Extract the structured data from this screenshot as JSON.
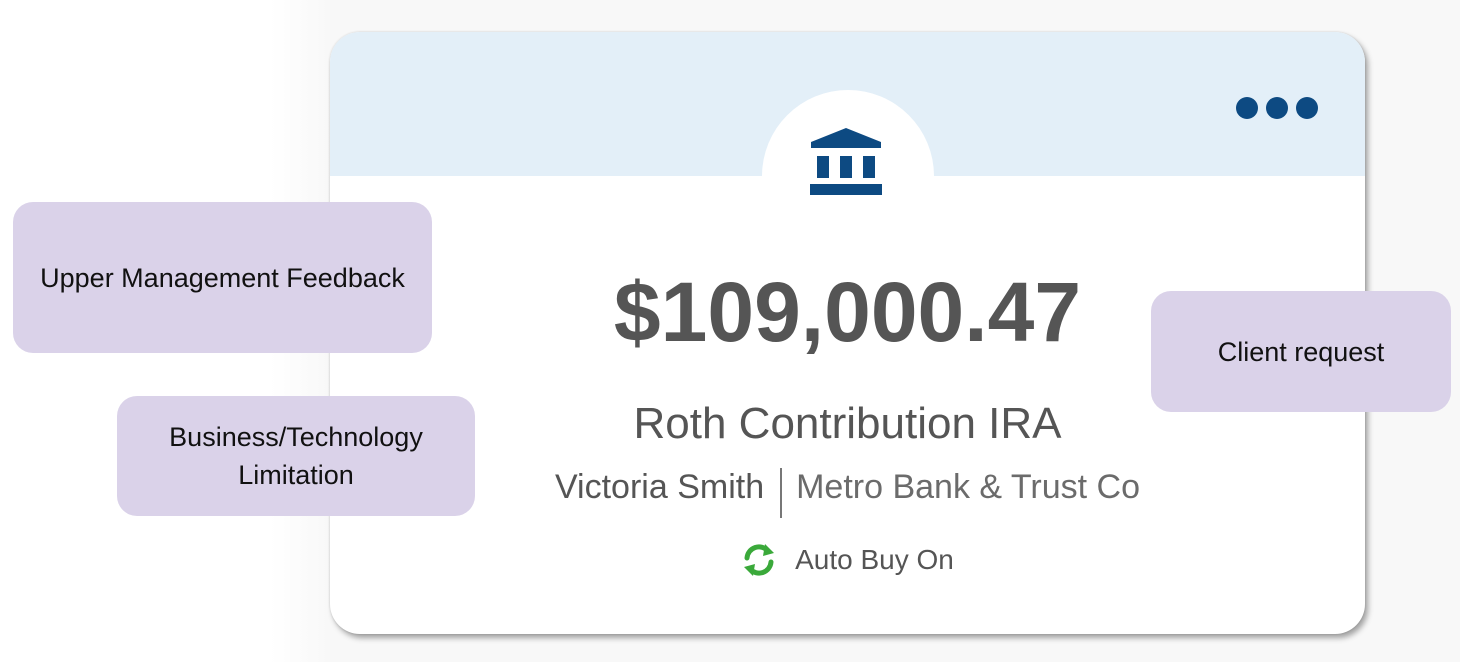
{
  "account_card": {
    "balance": "$109,000.47",
    "account_type": "Roth Contribution IRA",
    "owner": "Victoria Smith",
    "institution": "Metro Bank & Trust Co",
    "auto_buy_label": "Auto Buy On",
    "header_icon": "bank-icon",
    "menu_icon": "more-horizontal-icon",
    "auto_buy_icon": "refresh-icon"
  },
  "annotations": [
    {
      "text": "Upper Management Feedback"
    },
    {
      "text": "Business/Technology Limitation"
    },
    {
      "text": "Client request"
    }
  ],
  "colors": {
    "header_bg": "#e3eff8",
    "brand_navy": "#0d4a82",
    "auto_buy_green": "#3aa93a",
    "annotation_bg": "#dad2e9",
    "text_gray": "#555555"
  }
}
